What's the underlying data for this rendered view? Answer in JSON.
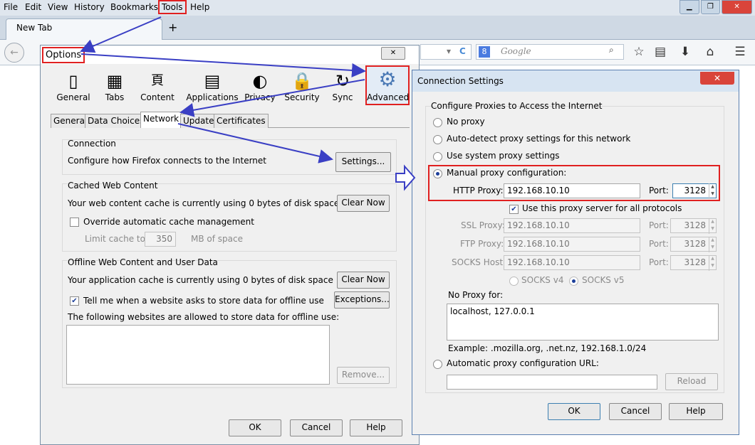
{
  "menubar": {
    "items": [
      "File",
      "Edit",
      "View",
      "History",
      "Bookmarks",
      "Tools",
      "Help"
    ]
  },
  "window_controls": {
    "minimize": "▁",
    "restore": "❐",
    "close": "✕"
  },
  "browser": {
    "tab_label": "New Tab",
    "new_tab_symbol": "+",
    "back_symbol": "←",
    "search_placeholder": "Google",
    "search_engine_letter": "8",
    "url_icons": [
      "▾",
      "C"
    ]
  },
  "options": {
    "title": "Options",
    "close_symbol": "✕",
    "panes": [
      {
        "label": "General",
        "icon": "▯"
      },
      {
        "label": "Tabs",
        "icon": "▦"
      },
      {
        "label": "Content",
        "icon": "頁"
      },
      {
        "label": "Applications",
        "icon": "▤"
      },
      {
        "label": "Privacy",
        "icon": "◐"
      },
      {
        "label": "Security",
        "icon": "🔒"
      },
      {
        "label": "Sync",
        "icon": "↻"
      },
      {
        "label": "Advanced",
        "icon": "⚙"
      }
    ],
    "subtabs": [
      "General",
      "Data Choices",
      "Network",
      "Update",
      "Certificates"
    ],
    "connection": {
      "heading": "Connection",
      "text": "Configure how Firefox connects to the Internet",
      "settings_button": "Settings..."
    },
    "cache": {
      "heading": "Cached Web Content",
      "text": "Your web content cache is currently using 0 bytes of disk space",
      "clear_button": "Clear Now",
      "override_label": "Override automatic cache management",
      "limit_label": "Limit cache to",
      "limit_value": "350",
      "limit_unit": "MB of space"
    },
    "offline": {
      "heading": "Offline Web Content and User Data",
      "text": "Your application cache is currently using 0 bytes of disk space",
      "clear_button": "Clear Now",
      "tell_me_label": "Tell me when a website asks to store data for offline use",
      "exceptions_button": "Exceptions...",
      "allowed_text": "The following websites are allowed to store data for offline use:",
      "remove_button": "Remove..."
    },
    "buttons": {
      "ok": "OK",
      "cancel": "Cancel",
      "help": "Help"
    }
  },
  "connection_settings": {
    "title": "Connection Settings",
    "close_symbol": "✕",
    "group_title": "Configure Proxies to Access the Internet",
    "options": {
      "no_proxy": "No proxy",
      "auto_detect": "Auto-detect proxy settings for this network",
      "system": "Use system proxy settings",
      "manual": "Manual proxy configuration:"
    },
    "http_label": "HTTP Proxy:",
    "http_value": "192.168.10.10",
    "port_label": "Port:",
    "http_port": "3128",
    "use_for_all_label": "Use this proxy server for all protocols",
    "ssl_label": "SSL Proxy:",
    "ssl_value": "192.168.10.10",
    "ssl_port": "3128",
    "ftp_label": "FTP Proxy:",
    "ftp_value": "192.168.10.10",
    "ftp_port": "3128",
    "socks_label": "SOCKS Host:",
    "socks_value": "192.168.10.10",
    "socks_port": "3128",
    "socks_v4": "SOCKS v4",
    "socks_v5": "SOCKS v5",
    "no_proxy_label": "No Proxy for:",
    "no_proxy_value": "localhost, 127.0.0.1",
    "example": "Example: .mozilla.org, .net.nz, 192.168.1.0/24",
    "auto_url_label": "Automatic proxy configuration URL:",
    "reload_button": "Reload",
    "buttons": {
      "ok": "OK",
      "cancel": "Cancel",
      "help": "Help"
    }
  },
  "colors": {
    "highlight": "#e02020",
    "arrow": "#3a3fc4"
  }
}
